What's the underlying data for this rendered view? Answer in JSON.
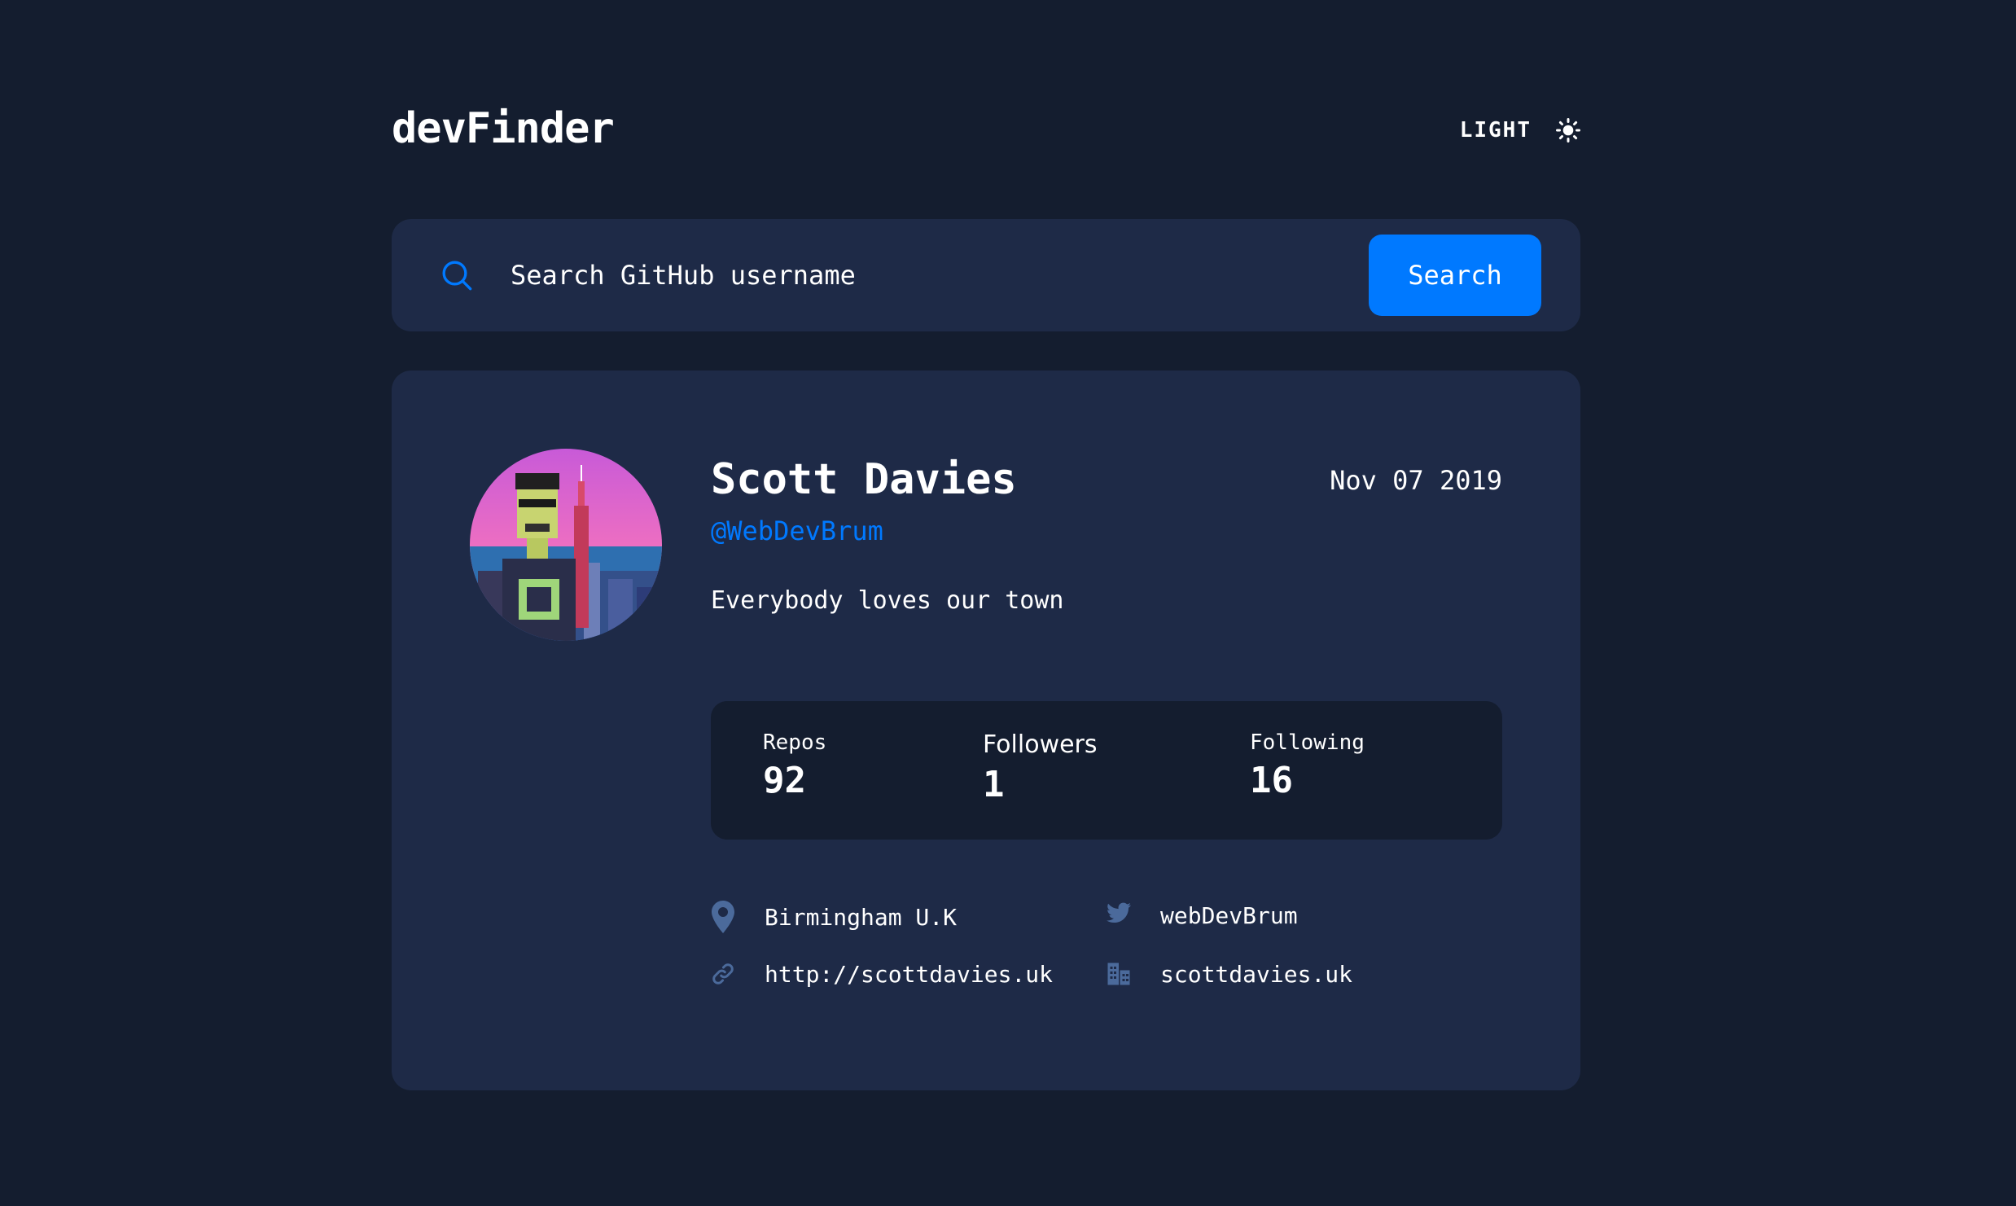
{
  "header": {
    "logo": "devFinder",
    "mode_label": "LIGHT",
    "mode_icon": "sun-icon"
  },
  "search": {
    "placeholder": "Search GitHub username",
    "value": "",
    "button_label": "Search",
    "icon": "search-icon"
  },
  "profile": {
    "name": "Scott Davies",
    "login": "@WebDevBrum",
    "joined": "Nov 07 2019",
    "bio": "Everybody loves our town",
    "stats": {
      "repos_label": "Repos",
      "repos_value": "92",
      "followers_label": "Followers",
      "followers_value": "1",
      "following_label": "Following",
      "following_value": "16"
    },
    "links": {
      "location": "Birmingham U.K",
      "twitter": "webDevBrum",
      "website": "http://scottdavies.uk",
      "company": "scottdavies.uk"
    }
  },
  "colors": {
    "background": "#141d2f",
    "card": "#1e2a47",
    "accent": "#0079ff",
    "text": "#ffffff",
    "icon_muted": "#4b6a9b"
  }
}
